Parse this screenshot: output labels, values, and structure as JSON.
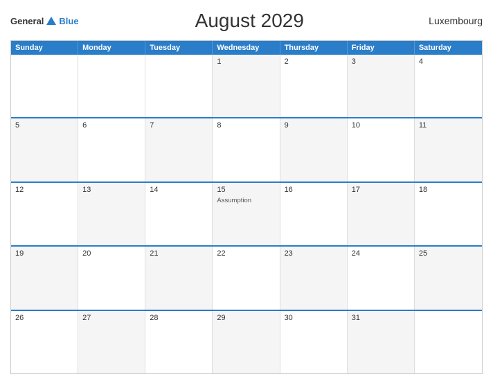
{
  "header": {
    "logo_general": "General",
    "logo_blue": "Blue",
    "title": "August 2029",
    "country": "Luxembourg"
  },
  "days_of_week": [
    "Sunday",
    "Monday",
    "Tuesday",
    "Wednesday",
    "Thursday",
    "Friday",
    "Saturday"
  ],
  "weeks": [
    [
      {
        "num": "",
        "event": "",
        "empty": true
      },
      {
        "num": "",
        "event": "",
        "empty": true
      },
      {
        "num": "",
        "event": "",
        "empty": true
      },
      {
        "num": "1",
        "event": ""
      },
      {
        "num": "2",
        "event": ""
      },
      {
        "num": "3",
        "event": ""
      },
      {
        "num": "4",
        "event": ""
      }
    ],
    [
      {
        "num": "5",
        "event": ""
      },
      {
        "num": "6",
        "event": ""
      },
      {
        "num": "7",
        "event": ""
      },
      {
        "num": "8",
        "event": ""
      },
      {
        "num": "9",
        "event": ""
      },
      {
        "num": "10",
        "event": ""
      },
      {
        "num": "11",
        "event": ""
      }
    ],
    [
      {
        "num": "12",
        "event": ""
      },
      {
        "num": "13",
        "event": ""
      },
      {
        "num": "14",
        "event": ""
      },
      {
        "num": "15",
        "event": "Assumption"
      },
      {
        "num": "16",
        "event": ""
      },
      {
        "num": "17",
        "event": ""
      },
      {
        "num": "18",
        "event": ""
      }
    ],
    [
      {
        "num": "19",
        "event": ""
      },
      {
        "num": "20",
        "event": ""
      },
      {
        "num": "21",
        "event": ""
      },
      {
        "num": "22",
        "event": ""
      },
      {
        "num": "23",
        "event": ""
      },
      {
        "num": "24",
        "event": ""
      },
      {
        "num": "25",
        "event": ""
      }
    ],
    [
      {
        "num": "26",
        "event": ""
      },
      {
        "num": "27",
        "event": ""
      },
      {
        "num": "28",
        "event": ""
      },
      {
        "num": "29",
        "event": ""
      },
      {
        "num": "30",
        "event": ""
      },
      {
        "num": "31",
        "event": ""
      },
      {
        "num": "",
        "event": "",
        "empty": true
      }
    ]
  ]
}
